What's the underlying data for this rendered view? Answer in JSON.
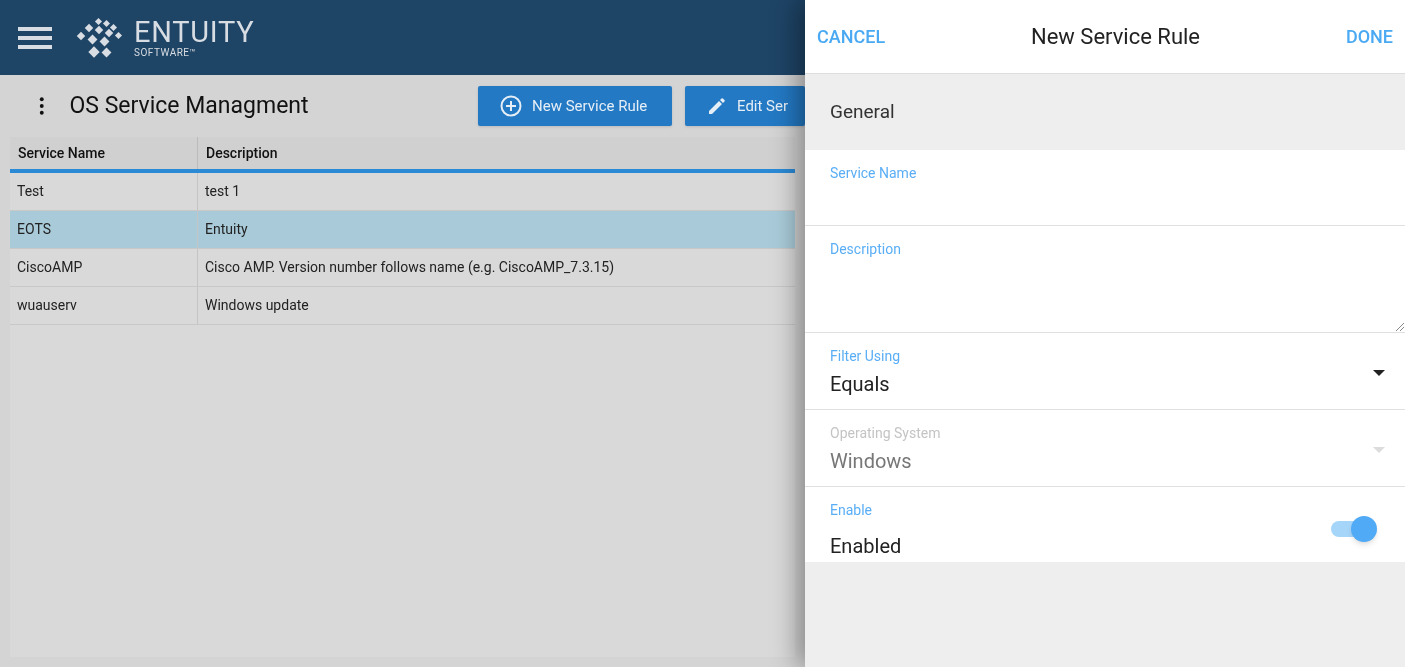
{
  "header": {
    "brand": "ENTUITY",
    "brand_sub": "SOFTWARE™"
  },
  "page": {
    "title": "OS Service Managment",
    "buttons": [
      {
        "kind": "add",
        "label": "New Service Rule"
      },
      {
        "kind": "edit",
        "label": "Edit Ser"
      }
    ]
  },
  "table": {
    "columns": [
      "Service Name",
      "Description"
    ],
    "rows": [
      {
        "cells": [
          "Test",
          "test 1"
        ],
        "selected": false
      },
      {
        "cells": [
          "EOTS",
          "Entuity"
        ],
        "selected": true
      },
      {
        "cells": [
          "CiscoAMP",
          "Cisco AMP. Version number follows name (e.g. CiscoAMP_7.3.15)"
        ],
        "selected": false
      },
      {
        "cells": [
          "wuauserv",
          "Windows update"
        ],
        "selected": false
      }
    ]
  },
  "panel": {
    "cancel": "CANCEL",
    "title": "New Service Rule",
    "done": "DONE",
    "section": "General",
    "fields": [
      {
        "kind": "text",
        "label": "Service Name"
      },
      {
        "kind": "textarea",
        "label": "Description"
      },
      {
        "kind": "select",
        "label": "Filter Using",
        "value": "Equals",
        "disabled": false
      },
      {
        "kind": "select",
        "label": "Operating System",
        "value": "Windows",
        "disabled": true
      },
      {
        "kind": "toggle",
        "label": "Enable",
        "value": "Enabled",
        "on": true
      }
    ]
  }
}
